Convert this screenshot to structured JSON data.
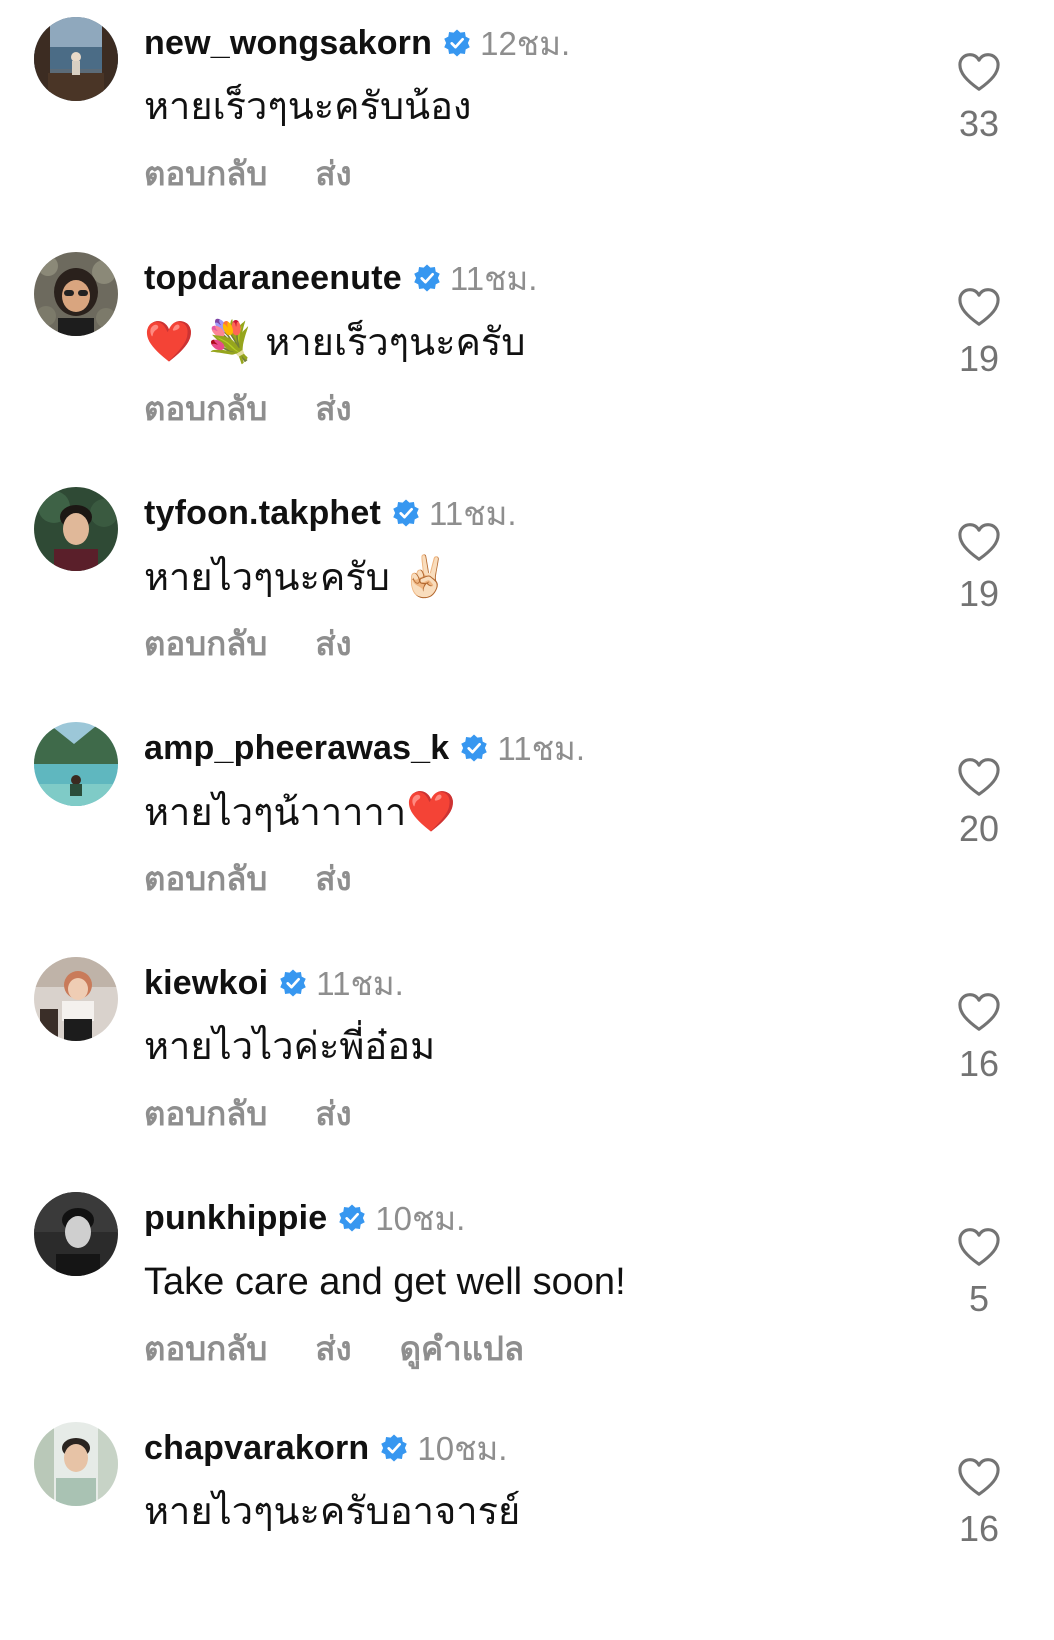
{
  "comments": [
    {
      "username": "new_wongsakorn",
      "time": "12ชม.",
      "text": "หายเร็วๆนะครับน้อง",
      "emoji": "",
      "reply_label": "ตอบกลับ",
      "send_label": "ส่ง",
      "translate_label": "",
      "likes": "33"
    },
    {
      "username": "topdaraneenute",
      "time": "11ชม.",
      "text": "หายเร็วๆนะครับ",
      "emoji": "❤️ 💐",
      "reply_label": "ตอบกลับ",
      "send_label": "ส่ง",
      "translate_label": "",
      "likes": "19"
    },
    {
      "username": "tyfoon.takphet",
      "time": "11ชม.",
      "text": "หายไวๆนะครับ",
      "emoji": "✌🏻",
      "reply_label": "ตอบกลับ",
      "send_label": "ส่ง",
      "translate_label": "",
      "likes": "19"
    },
    {
      "username": "amp_pheerawas_k",
      "time": "11ชม.",
      "text": "หายไวๆน้าาาาา",
      "emoji": "❤️",
      "reply_label": "ตอบกลับ",
      "send_label": "ส่ง",
      "translate_label": "",
      "likes": "20"
    },
    {
      "username": "kiewkoi",
      "time": "11ชม.",
      "text": "หายไวไวค่ะพี่อ๋อม",
      "emoji": "",
      "reply_label": "ตอบกลับ",
      "send_label": "ส่ง",
      "translate_label": "",
      "likes": "16"
    },
    {
      "username": "punkhippie",
      "time": "10ชม.",
      "text": "Take care and get well soon!",
      "emoji": "",
      "reply_label": "ตอบกลับ",
      "send_label": "ส่ง",
      "translate_label": "ดูคำแปล",
      "likes": "5"
    },
    {
      "username": "chapvarakorn",
      "time": "10ชม.",
      "text": "หายไวๆนะครับอาจารย์",
      "emoji": "",
      "reply_label": "",
      "send_label": "",
      "translate_label": "",
      "likes": "16"
    }
  ],
  "colors": {
    "verified_badge": "#3797f0",
    "secondary_text": "#8e8e8e",
    "primary_text": "#111111",
    "heart_outline": "#737373"
  },
  "icons": {
    "verified": "verified-badge-icon",
    "like": "heart-outline-icon"
  }
}
